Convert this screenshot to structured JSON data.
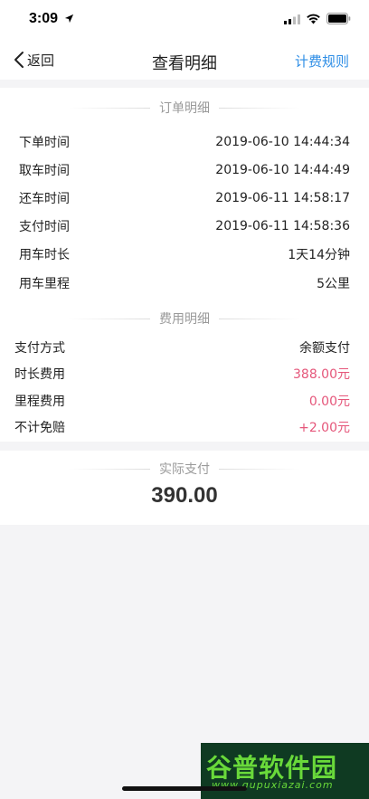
{
  "status_bar": {
    "time": "3:09"
  },
  "nav": {
    "back_label": "返回",
    "title": "查看明细",
    "rules_label": "计费规则",
    "accent_color": "#2e8ee6"
  },
  "order_section": {
    "title": "订单明细",
    "rows": [
      {
        "label": "下单时间",
        "value": "2019-06-10 14:44:34"
      },
      {
        "label": "取车时间",
        "value": "2019-06-10 14:44:49"
      },
      {
        "label": "还车时间",
        "value": "2019-06-11 14:58:17"
      },
      {
        "label": "支付时间",
        "value": "2019-06-11 14:58:36"
      },
      {
        "label": "用车时长",
        "value": "1天14分钟"
      },
      {
        "label": "用车里程",
        "value": "5公里"
      }
    ]
  },
  "fee_section": {
    "title": "费用明细",
    "highlight_color": "#e5567a",
    "rows": [
      {
        "label": "支付方式",
        "value": "余额支付"
      },
      {
        "label": "时长费用",
        "value": "388.00元"
      },
      {
        "label": "里程费用",
        "value": "0.00元"
      },
      {
        "label": "不计免赔",
        "value": "+2.00元"
      }
    ]
  },
  "payment": {
    "title": "实际支付",
    "amount": "390.00"
  },
  "watermark": {
    "text": "谷普软件园",
    "url": "www.gupuxiazai.com"
  },
  "icons": [
    "location-arrow-icon",
    "signal-icon",
    "wifi-icon",
    "battery-icon",
    "chevron-left-icon"
  ]
}
